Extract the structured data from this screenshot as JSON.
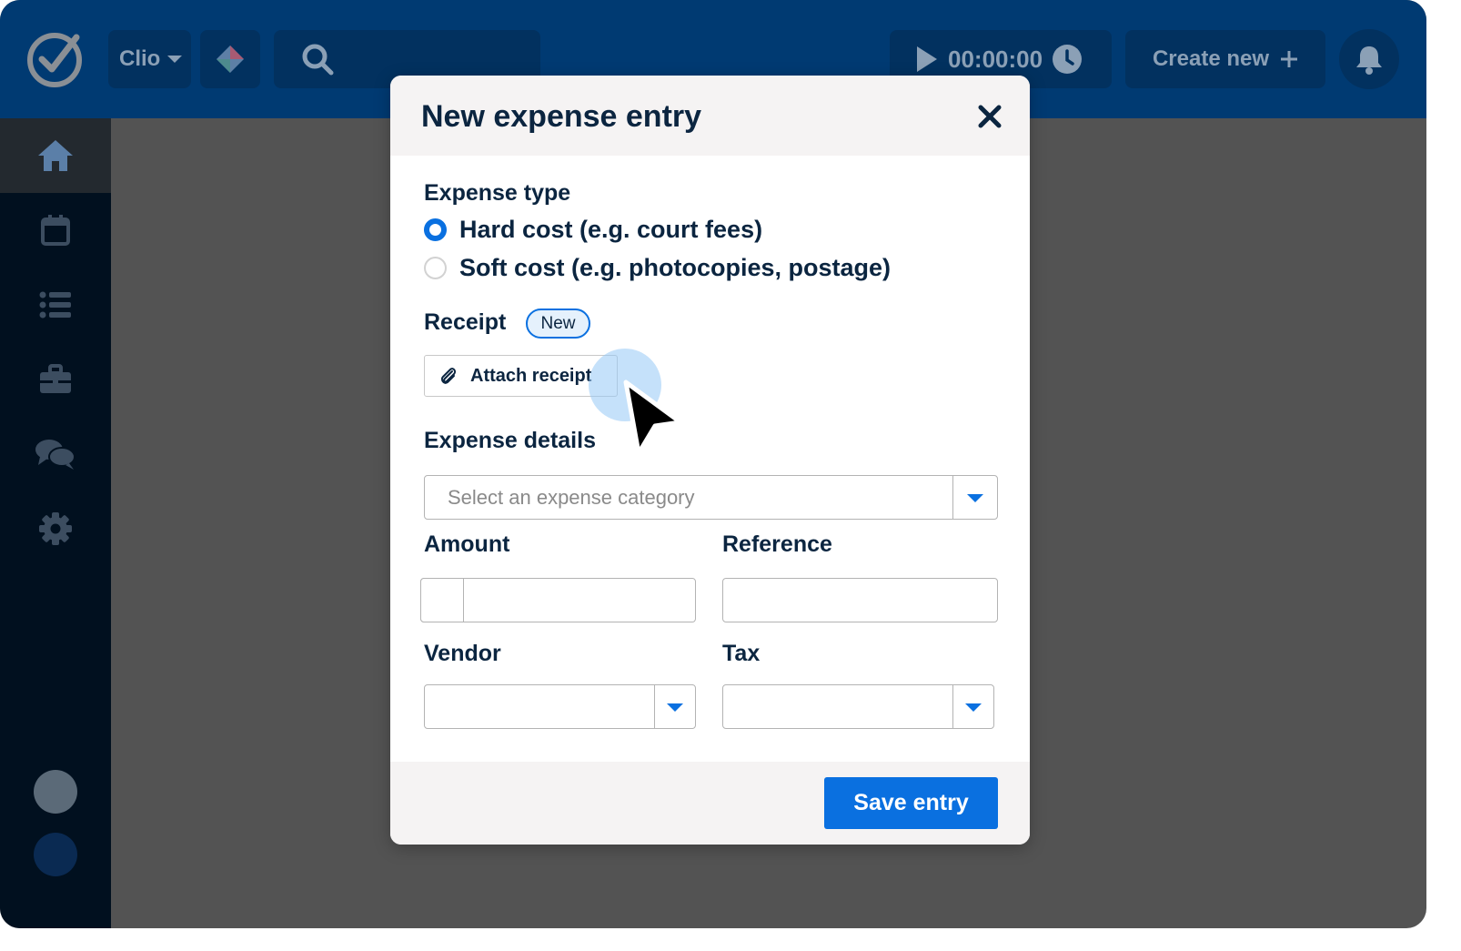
{
  "topbar": {
    "brand": "Clio",
    "timer": "00:00:00",
    "create_new": "Create new"
  },
  "icons": {
    "logo": "check-circle-icon",
    "search": "search-icon",
    "play": "play-icon",
    "clock": "clock-icon",
    "plus": "plus-icon",
    "bell": "bell-icon",
    "home": "home-icon",
    "calendar": "calendar-icon",
    "tasks": "list-icon",
    "matters": "briefcase-icon",
    "communications": "chat-icon",
    "settings": "gear-icon",
    "close": "close-icon",
    "paperclip": "paperclip-icon"
  },
  "modal": {
    "title": "New expense entry",
    "expense_type_label": "Expense type",
    "options": [
      {
        "label": "Hard cost (e.g. court fees)",
        "selected": true
      },
      {
        "label": "Soft cost (e.g. photocopies, postage)",
        "selected": false
      }
    ],
    "receipt_label": "Receipt",
    "receipt_badge": "New",
    "attach_button": "Attach receipt",
    "details_label": "Expense details",
    "category_placeholder": "Select an expense category",
    "amount_label": "Amount",
    "reference_label": "Reference",
    "vendor_label": "Vendor",
    "tax_label": "Tax",
    "save_button": "Save entry"
  },
  "colors": {
    "accent": "#0a70e0",
    "topbar": "#003a72",
    "sidebar": "#01101f",
    "overlay": "#535353",
    "heading": "#0b2540"
  }
}
